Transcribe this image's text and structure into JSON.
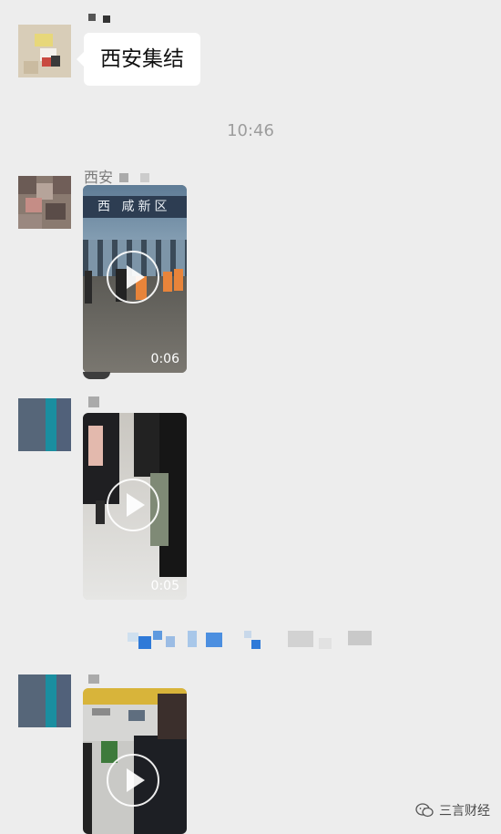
{
  "chat": {
    "message1": {
      "text": "西安集结"
    },
    "timestamp": "10:46",
    "message2": {
      "sender": "西安"
    },
    "video1": {
      "duration": "0:06",
      "sign_text": "西 咸新区"
    },
    "video2": {
      "duration": "0:05"
    },
    "video3": {
      "duration": ""
    }
  },
  "watermark": {
    "text": "三言财经",
    "icon": "wechat-icon"
  },
  "colors": {
    "background": "#ededed",
    "bubble": "#ffffff",
    "timestamp": "#9d9d9d"
  }
}
